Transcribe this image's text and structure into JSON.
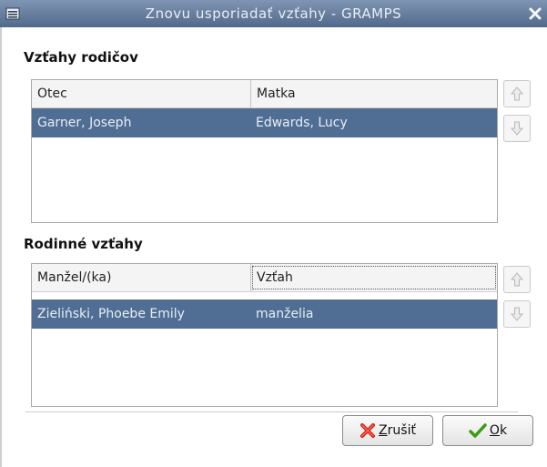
{
  "window": {
    "title": "Znovu usporiadať vzťahy - GRAMPS"
  },
  "parents_section": {
    "label": "Vzťahy rodičov",
    "columns": [
      "Otec",
      "Matka"
    ],
    "rows": [
      {
        "father": "Garner, Joseph",
        "mother": "Edwards, Lucy",
        "selected": true
      }
    ]
  },
  "family_section": {
    "label": "Rodinné vzťahy",
    "columns": [
      "Manžel/(ka)",
      "Vzťah"
    ],
    "rows": [
      {
        "spouse": "Zieliński, Phoebe Emily",
        "relationship": "manželia",
        "selected": true
      }
    ]
  },
  "buttons": {
    "cancel_prefix": "Z",
    "cancel_rest": "rušiť",
    "ok_prefix": "O",
    "ok_rest": "k"
  },
  "colors": {
    "selection": "#506e94",
    "titlebar": "#5c7396"
  },
  "icons": {
    "window_menu": "menu-icon",
    "close": "close-icon",
    "move_up": "arrow-up-icon",
    "move_down": "arrow-down-icon",
    "cancel": "red-x-icon",
    "ok": "green-checkmark-icon"
  }
}
